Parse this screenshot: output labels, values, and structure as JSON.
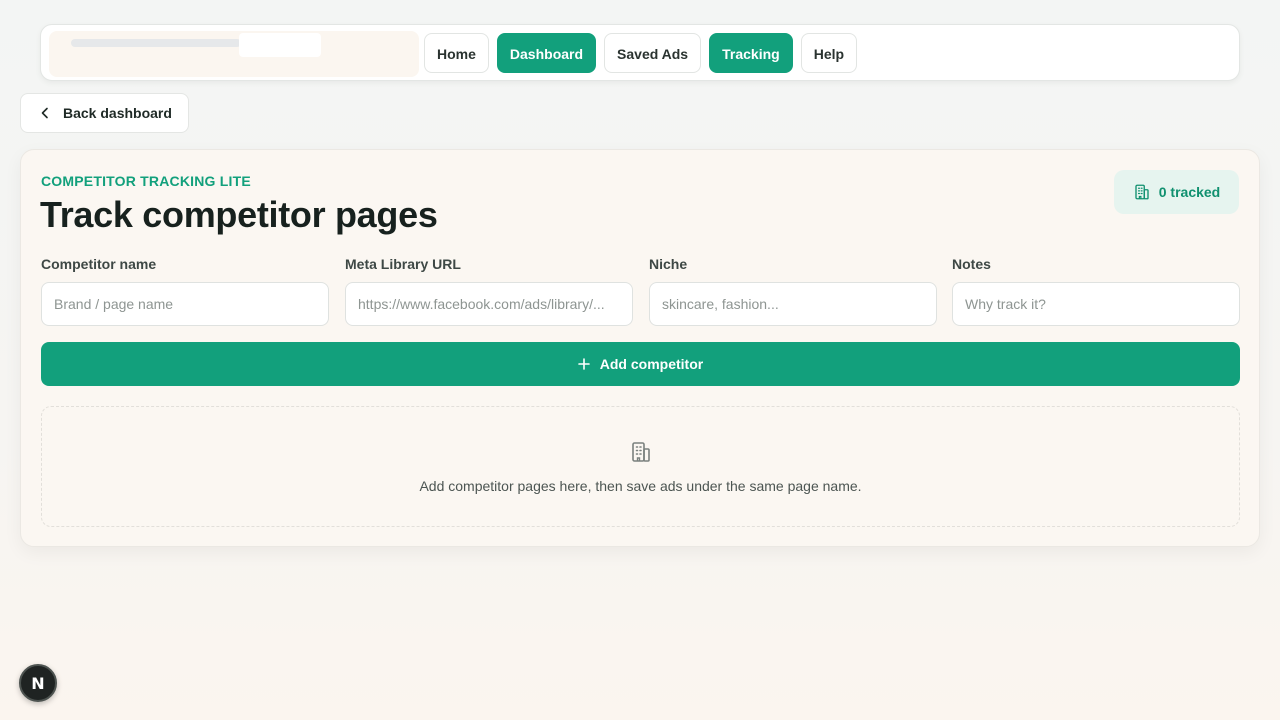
{
  "nav": {
    "items": [
      {
        "label": "Home",
        "active": false
      },
      {
        "label": "Dashboard",
        "active": true
      },
      {
        "label": "Saved Ads",
        "active": false
      },
      {
        "label": "Tracking",
        "active": true
      },
      {
        "label": "Help",
        "active": false
      }
    ]
  },
  "back": {
    "label": "Back dashboard",
    "icon": "chevron-left-icon"
  },
  "card": {
    "eyebrow": "COMPETITOR TRACKING LITE",
    "title": "Track competitor pages",
    "tracked_badge": {
      "label": "0 tracked",
      "icon": "building-icon"
    }
  },
  "form": {
    "competitor_name": {
      "label": "Competitor name",
      "placeholder": "Brand / page name",
      "value": ""
    },
    "meta_url": {
      "label": "Meta Library URL",
      "placeholder": "https://www.facebook.com/ads/library/...",
      "value": ""
    },
    "niche": {
      "label": "Niche",
      "placeholder": "skincare, fashion...",
      "value": ""
    },
    "notes": {
      "label": "Notes",
      "placeholder": "Why track it?",
      "value": ""
    },
    "add_button": {
      "label": "Add competitor",
      "icon": "plus-icon"
    }
  },
  "empty_state": {
    "icon": "building-icon",
    "text": "Add competitor pages here, then save ads under the same page name."
  },
  "dev_badge": {
    "label": "N"
  },
  "colors": {
    "accent": "#12a07c",
    "accent_soft": "#e6f4ef",
    "text": "#17211e"
  }
}
